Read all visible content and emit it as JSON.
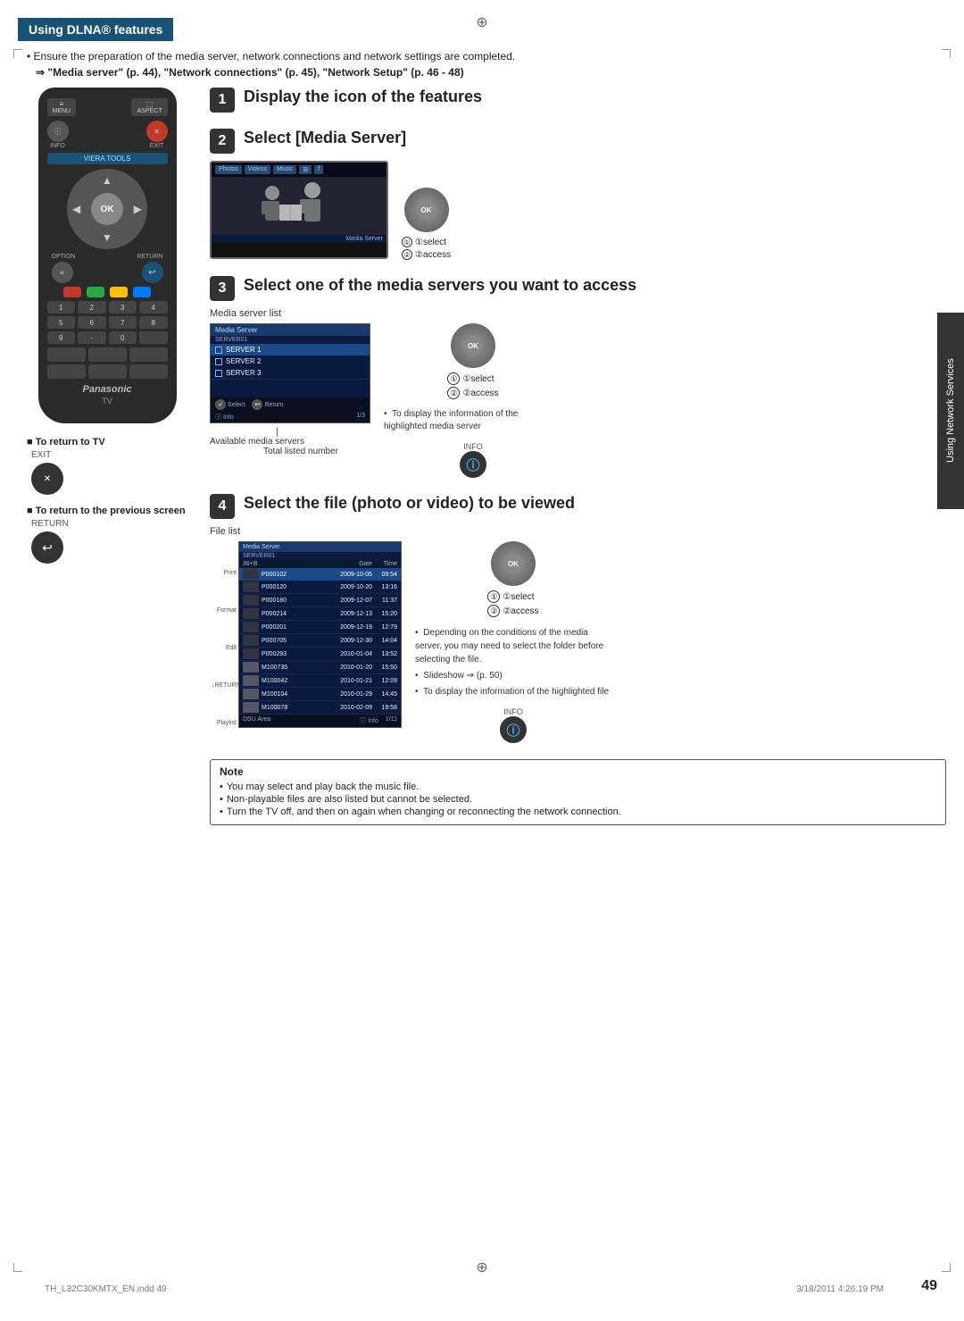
{
  "page": {
    "number": "49",
    "section": "Using Network Services",
    "footer_left": "TH_L32C30KMTX_EN.indd  49",
    "footer_right": "3/18/2011  4:26:19 PM"
  },
  "header": {
    "title": "Using DLNA® features"
  },
  "intro": {
    "line1": "Ensure the preparation of the media server, network connections and network settings are completed.",
    "line2": "⇒ \"Media server\" (p. 44), \"Network connections\" (p. 45), \"Network Setup\" (p. 46 - 48)"
  },
  "steps": [
    {
      "number": "1",
      "title": "Display the icon of the features"
    },
    {
      "number": "2",
      "title": "Select [Media Server]",
      "select_label": "①select",
      "access_label": "②access"
    },
    {
      "number": "3",
      "title": "Select one of the media servers you want to access",
      "screen_label": "Media server list",
      "server_header": "Media Server",
      "server_subtitle": "SERVER01",
      "servers": [
        "SERVER 1",
        "SERVER 2",
        "SERVER 3"
      ],
      "select_label": "①select",
      "access_label": "②access",
      "info_label": "INFO",
      "info_note": "To display the information of the highlighted media server",
      "available_label": "Available media servers",
      "total_label": "Total listed number"
    },
    {
      "number": "4",
      "title": "Select the file (photo or video) to be viewed",
      "screen_label": "File list",
      "server_header": "Media Server",
      "server_subtitle": "SERVER01",
      "files": [
        {
          "name": "P000102",
          "date": "2009-10-05",
          "time": "09:54"
        },
        {
          "name": "P000120",
          "date": "2009-10-20",
          "time": "13:16"
        },
        {
          "name": "P000180",
          "date": "2009-12-07",
          "time": "11:37"
        },
        {
          "name": "P000214",
          "date": "2009-12-13",
          "time": "15:20"
        },
        {
          "name": "P000201",
          "date": "2009-12-19",
          "time": "12:79"
        },
        {
          "name": "P000705",
          "date": "2009-12-30",
          "time": "14:04"
        },
        {
          "name": "P000293",
          "date": "2010-01-04",
          "time": "13:52"
        },
        {
          "name": "M100735",
          "date": "2010-01-20",
          "time": "15:50"
        },
        {
          "name": "M100042",
          "date": "2010-01-21",
          "time": "12:09"
        },
        {
          "name": "M100104",
          "date": "2010-01-29",
          "time": "14:45"
        },
        {
          "name": "M100078",
          "date": "2010-02-09",
          "time": "19:58"
        }
      ],
      "select_label": "①select",
      "access_label": "②access",
      "info_label": "INFO",
      "note1": "Depending on the conditions of the media server, you may need to select the folder before selecting the file.",
      "note2": "Slideshow ⇒ (p. 50)",
      "note3": "To display the information of the highlighted file",
      "sidebar_labels": [
        "Print",
        "Format",
        "Edit",
        "RETURN",
        "Playlist"
      ]
    }
  ],
  "left_panel": {
    "return_tv_label": "■ To return to TV",
    "exit_label": "EXIT",
    "return_prev_label": "■ To return to the previous screen",
    "return_label": "RETURN"
  },
  "notes": {
    "title": "Note",
    "items": [
      "You may select and play back the music file.",
      "Non-playable files are also listed but cannot be selected.",
      "Turn the TV off, and then on again when changing or reconnecting the network connection."
    ]
  },
  "remote": {
    "menu_label": "MENU",
    "aspect_label": "ASPECT",
    "info_label": "INFO",
    "exit_label": "EXIT",
    "viera_tools": "VIERA TOOLS",
    "ok_label": "OK",
    "option_label": "OPTION",
    "return_label": "RETURN",
    "brand": "Panasonic",
    "tv_label": "TV",
    "color_btns": [
      "red",
      "#28a745",
      "#ffc107",
      "#007bff"
    ]
  }
}
